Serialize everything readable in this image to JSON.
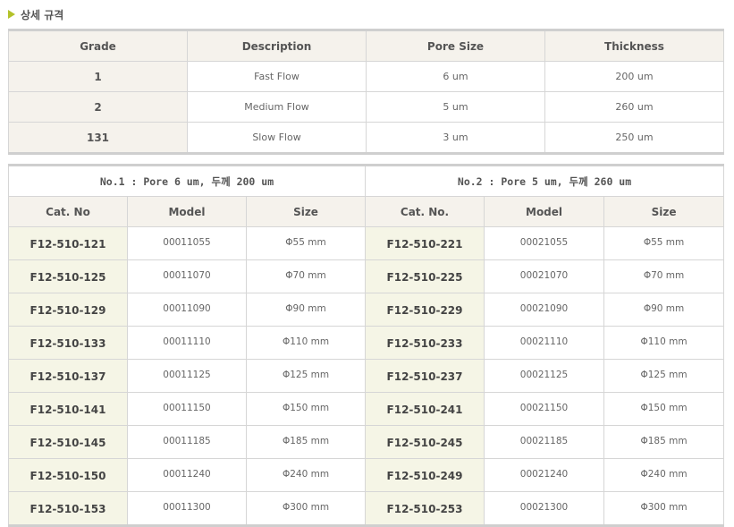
{
  "section": {
    "title": "상세 규격",
    "icon": "triangle-bullet-icon",
    "accent_color": "#b3c22a"
  },
  "grade_table": {
    "headers": [
      "Grade",
      "Description",
      "Pore Size",
      "Thickness"
    ],
    "rows": [
      {
        "grade": "1",
        "description": "Fast Flow",
        "pore": "6 um",
        "thickness": "200 um"
      },
      {
        "grade": "2",
        "description": "Medium Flow",
        "pore": "5 um",
        "thickness": "260 um"
      },
      {
        "grade": "131",
        "description": "Slow Flow",
        "pore": "3 um",
        "thickness": "250 um"
      }
    ]
  },
  "catalog_table": {
    "group_left": "No.1 : Pore 6 um, 두께 200 um",
    "group_right": "No.2 : Pore 5 um, 두께 260 um",
    "headers_left": [
      "Cat. No",
      "Model",
      "Size"
    ],
    "headers_right": [
      "Cat. No.",
      "Model",
      "Size"
    ],
    "rows": [
      {
        "cat1": "F12-510-121",
        "model1": "00011055",
        "size1": "Φ55 mm",
        "cat2": "F12-510-221",
        "model2": "00021055",
        "size2": "Φ55 mm"
      },
      {
        "cat1": "F12-510-125",
        "model1": "00011070",
        "size1": "Φ70 mm",
        "cat2": "F12-510-225",
        "model2": "00021070",
        "size2": "Φ70 mm"
      },
      {
        "cat1": "F12-510-129",
        "model1": "00011090",
        "size1": "Φ90 mm",
        "cat2": "F12-510-229",
        "model2": "00021090",
        "size2": "Φ90 mm"
      },
      {
        "cat1": "F12-510-133",
        "model1": "00011110",
        "size1": "Φ110 mm",
        "cat2": "F12-510-233",
        "model2": "00021110",
        "size2": "Φ110 mm"
      },
      {
        "cat1": "F12-510-137",
        "model1": "00011125",
        "size1": "Φ125 mm",
        "cat2": "F12-510-237",
        "model2": "00021125",
        "size2": "Φ125 mm"
      },
      {
        "cat1": "F12-510-141",
        "model1": "00011150",
        "size1": "Φ150 mm",
        "cat2": "F12-510-241",
        "model2": "00021150",
        "size2": "Φ150 mm"
      },
      {
        "cat1": "F12-510-145",
        "model1": "00011185",
        "size1": "Φ185 mm",
        "cat2": "F12-510-245",
        "model2": "00021185",
        "size2": "Φ185 mm"
      },
      {
        "cat1": "F12-510-150",
        "model1": "00011240",
        "size1": "Φ240 mm",
        "cat2": "F12-510-249",
        "model2": "00021240",
        "size2": "Φ240 mm"
      },
      {
        "cat1": "F12-510-153",
        "model1": "00011300",
        "size1": "Φ300 mm",
        "cat2": "F12-510-253",
        "model2": "00021300",
        "size2": "Φ300 mm"
      }
    ]
  }
}
